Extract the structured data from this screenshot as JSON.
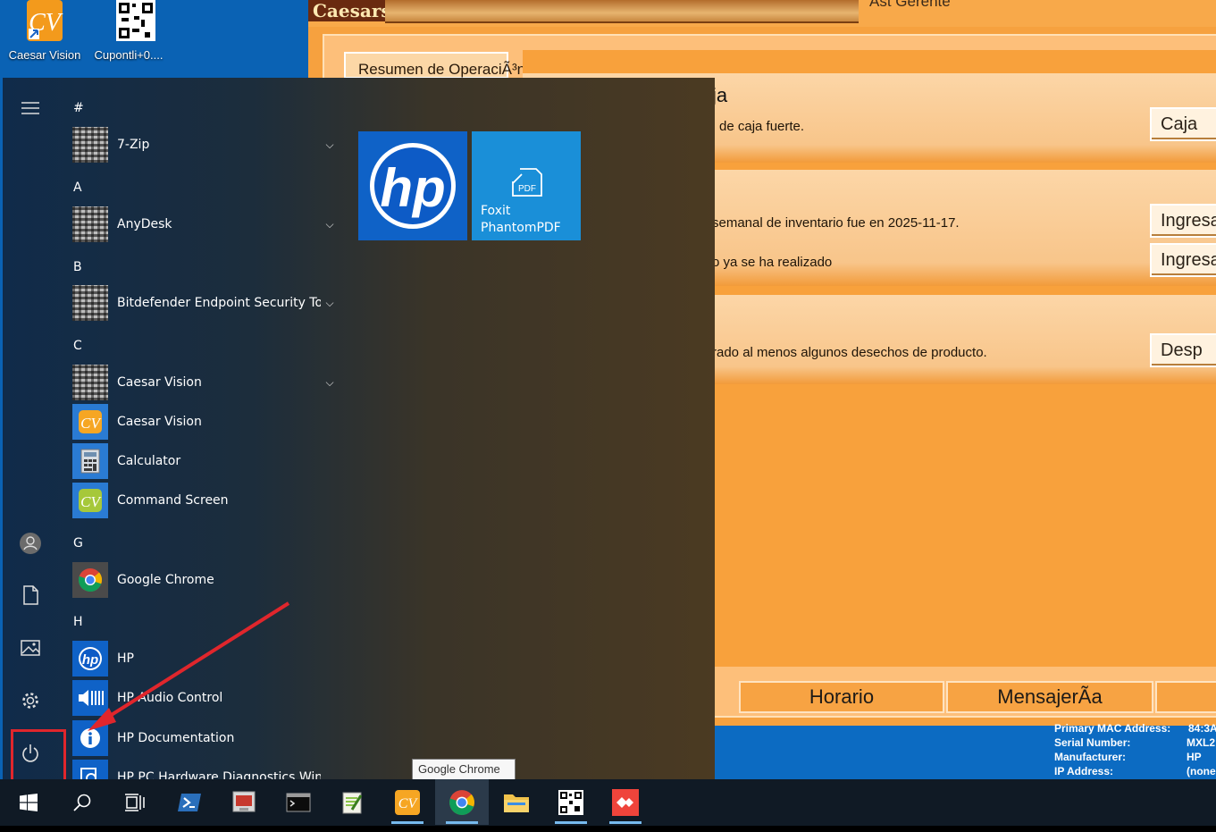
{
  "desktop": {
    "icons": [
      {
        "label": "Caesar Vision",
        "icon": "caesar-vision-icon"
      },
      {
        "label": "Cupontli+0....",
        "icon": "qr-code-icon"
      }
    ]
  },
  "background_app": {
    "logo": "Caesars",
    "role": "Ast Gerente",
    "tab_resumen": "Resumen de OperaciÃ³n",
    "section_title": "ja",
    "rows": [
      {
        "text": "de caja fuerte.",
        "button": "Caja"
      },
      {
        "text": "semanal de inventario fue en 2025-11-17.",
        "button": "Ingresar"
      },
      {
        "text": "o ya se ha realizado",
        "button": "Ingresar"
      },
      {
        "text": "rado al menos algunos desechos de producto.",
        "button": "Desp"
      }
    ],
    "bottom_tabs": [
      "Horario",
      "MensajerÃ­a"
    ],
    "machine_info": {
      "labels": [
        "Primary MAC Address:",
        "Serial Number:",
        "Manufacturer:",
        "IP Address:"
      ],
      "values": [
        "84:3A",
        "MXL2",
        "HP",
        "(none"
      ]
    }
  },
  "start_menu": {
    "rail": {
      "menu": "hamburger-icon",
      "user": "user-icon",
      "documents": "document-icon",
      "pictures": "pictures-icon",
      "settings": "gear-icon",
      "power": "power-icon"
    },
    "groups": [
      {
        "letter": "#",
        "items": [
          {
            "name": "7-Zip",
            "expand": true
          }
        ]
      },
      {
        "letter": "A",
        "items": [
          {
            "name": "AnyDesk",
            "expand": true
          }
        ]
      },
      {
        "letter": "B",
        "items": [
          {
            "name": "Bitdefender Endpoint Security To...",
            "expand": true
          }
        ]
      },
      {
        "letter": "C",
        "items": [
          {
            "name": "Caesar Vision",
            "expand": true
          },
          {
            "name": "Caesar Vision",
            "expand": false
          },
          {
            "name": "Calculator",
            "expand": false
          },
          {
            "name": "Command Screen",
            "expand": false
          }
        ]
      },
      {
        "letter": "G",
        "items": [
          {
            "name": "Google Chrome",
            "expand": false
          }
        ]
      },
      {
        "letter": "H",
        "items": [
          {
            "name": "HP",
            "expand": false
          },
          {
            "name": "HP Audio Control",
            "expand": false
          },
          {
            "name": "HP Documentation",
            "expand": false
          },
          {
            "name": "HP PC Hardware Diagnostics Windo...",
            "expand": false
          }
        ]
      }
    ],
    "tiles": [
      {
        "name": "HP",
        "label": ""
      },
      {
        "name": "Foxit PhantomPDF",
        "label_line1": "Foxit",
        "label_line2": "PhantomPDF"
      }
    ]
  },
  "tooltip": "Google Chrome",
  "taskbar": {
    "buttons": [
      "start",
      "search",
      "task-view",
      "powershell",
      "remote-desktop",
      "terminal",
      "notepad-plus",
      "caesar-vision",
      "google-chrome",
      "file-explorer",
      "qr-app",
      "anydesk"
    ]
  },
  "colors": {
    "app_orange": "#f6a13f",
    "desktop_blue": "#0a62b4",
    "annotation_red": "#e0262c",
    "taskbar": "#101a25"
  }
}
